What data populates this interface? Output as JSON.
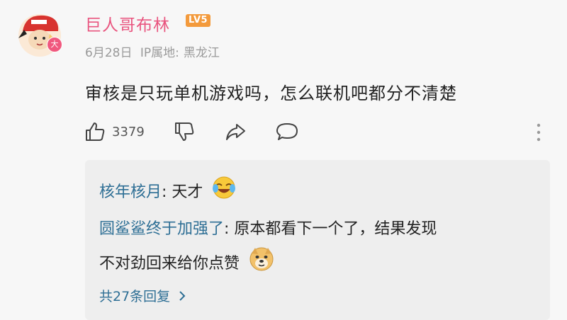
{
  "comment": {
    "username": "巨人哥布林",
    "level_badge": "LV5",
    "avatar_badge": "大",
    "date": "6月28日",
    "ip_label": "IP属地:",
    "ip_location": "黑龙江",
    "text": "审核是只玩单机游戏吗，怎么联机吧都分不清楚",
    "like_count": "3379"
  },
  "replies": [
    {
      "name": "核年核月",
      "separator": ": ",
      "text": "天才",
      "emoji": "laughing-tears-emoji"
    },
    {
      "name": "圆鲨鲨终于加强了",
      "separator": ": ",
      "text": "原本都看下一个了，结果发现",
      "text2": "不对劲回来给你点赞",
      "emoji": "doge-emoji"
    }
  ],
  "more_replies_label": "共27条回复",
  "colors": {
    "username": "#e9557f",
    "reply_name": "#2e6f95",
    "level_badge": "#f39a3c"
  },
  "icons": [
    "thumb-up-icon",
    "thumb-down-icon",
    "share-icon",
    "comment-icon",
    "more-vertical-icon",
    "chevron-right-icon"
  ]
}
